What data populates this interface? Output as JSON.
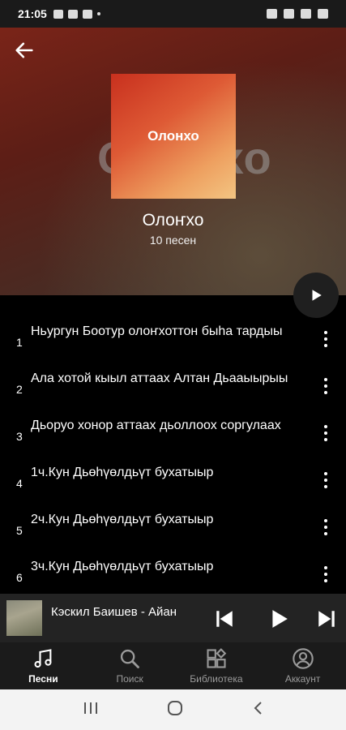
{
  "status_bar": {
    "time": "21:05"
  },
  "album": {
    "cover_label": "Олонхо",
    "background_text": "Олонхо",
    "title": "Олоҥхо",
    "subtitle": "10 песен"
  },
  "tracks": [
    {
      "number": "1",
      "title": "Ньургун Боотур олоҥхоттон быhа тардыы"
    },
    {
      "number": "2",
      "title": "Ала хотой кыыл аттаах  Алтан Дьааыырыы"
    },
    {
      "number": "3",
      "title": "Дьоруо хонор аттаах дьоллоох соргулаах"
    },
    {
      "number": "4",
      "title": "1ч.Кун Дьөһүөлдьүт бухатыыр"
    },
    {
      "number": "5",
      "title": "2ч.Кун Дьөһүөлдьүт бухатыыр"
    },
    {
      "number": "6",
      "title": "3ч.Кун Дьөһүөлдьүт бухатыыр"
    }
  ],
  "mini_player": {
    "title": "Кэскил Баишев - Айан"
  },
  "nav": [
    {
      "label": "Песни",
      "icon": "music-note-icon",
      "active": true
    },
    {
      "label": "Поиск",
      "icon": "search-icon",
      "active": false
    },
    {
      "label": "Библиотека",
      "icon": "library-icon",
      "active": false
    },
    {
      "label": "Аккаунт",
      "icon": "account-icon",
      "active": false
    }
  ],
  "colors": {
    "accent_play": "#1f1f1f",
    "header_top": "#7a2418",
    "cover_start": "#c8301e",
    "cover_end": "#f3c582"
  }
}
